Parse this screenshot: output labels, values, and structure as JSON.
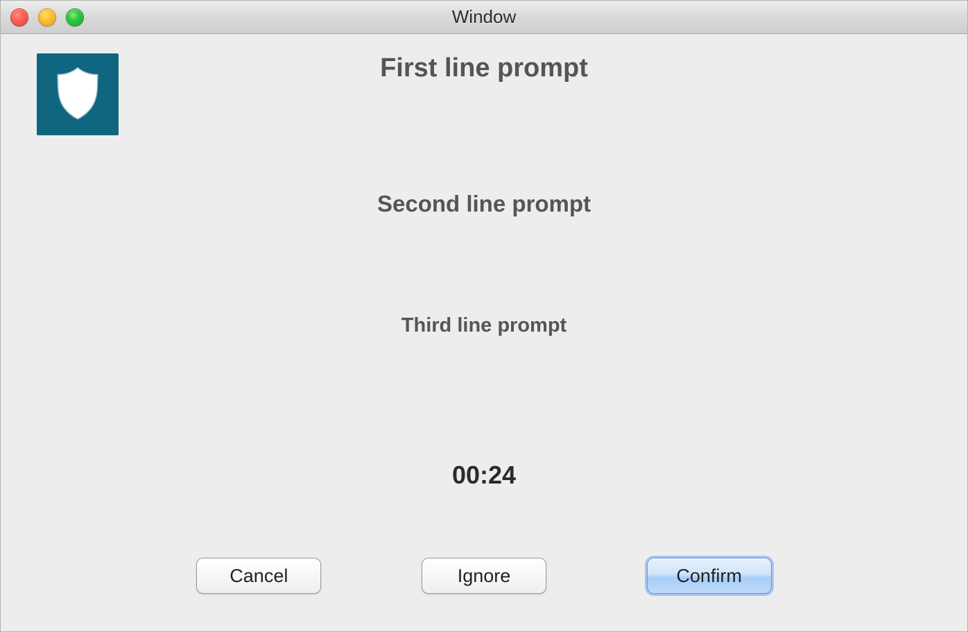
{
  "window": {
    "title": "Window"
  },
  "icon": {
    "name": "shield-icon"
  },
  "prompts": {
    "line1": "First line prompt",
    "line2": "Second line prompt",
    "line3": "Third line prompt"
  },
  "timer": {
    "value": "00:24"
  },
  "buttons": {
    "cancel": "Cancel",
    "ignore": "Ignore",
    "confirm": "Confirm"
  }
}
